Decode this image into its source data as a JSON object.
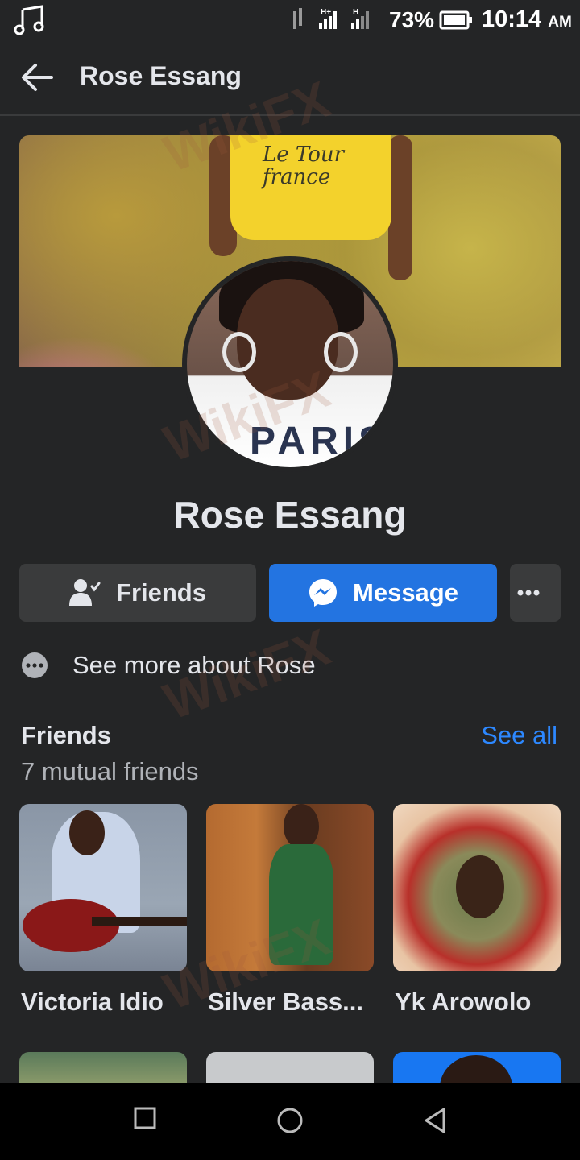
{
  "status_bar": {
    "battery_percent": "73%",
    "time": "10:14",
    "ampm": "AM",
    "icons": [
      "music-note-icon",
      "data-arrows-icon",
      "signal-hplus-icon",
      "signal-h-icon",
      "battery-icon"
    ]
  },
  "header": {
    "title": "Rose Essang",
    "back_icon": "arrow-left-icon"
  },
  "profile": {
    "name": "Rose Essang",
    "cover_shirt_text": "Le Tour france",
    "avatar_shirt_text": "PARIS"
  },
  "actions": {
    "friends_label": "Friends",
    "message_label": "Message",
    "more_icon": "ellipsis-icon"
  },
  "about": {
    "label": "See more about Rose"
  },
  "friends_section": {
    "title": "Friends",
    "see_all": "See all",
    "mutual": "7 mutual friends",
    "items": [
      {
        "name": "Victoria Idio"
      },
      {
        "name": "Silver Bass..."
      },
      {
        "name": "Yk Arowolo"
      }
    ]
  },
  "watermark": "WikiFX",
  "nav_bar": {
    "icons": [
      "recent-apps-icon",
      "home-icon",
      "back-triangle-icon"
    ]
  },
  "colors": {
    "background": "#242526",
    "accent": "#2374e1",
    "link": "#2d88ff",
    "button_gray": "#3a3b3c"
  }
}
